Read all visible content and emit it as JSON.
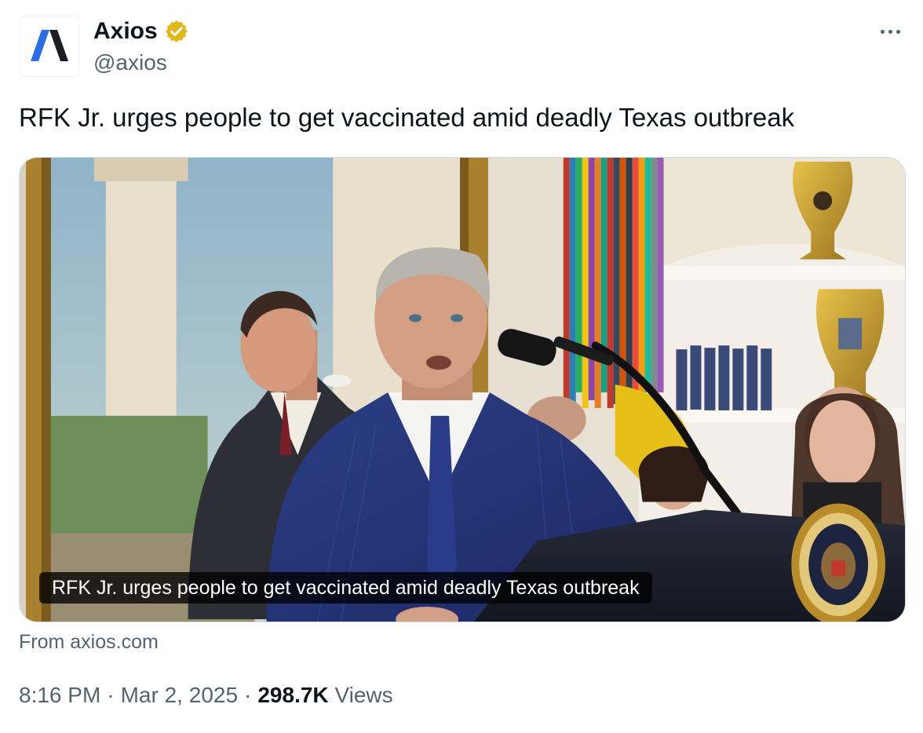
{
  "author": {
    "display_name": "Axios",
    "handle": "@axios",
    "verified": true,
    "verified_color": "#e2b719"
  },
  "tweet": {
    "text": "RFK Jr. urges people to get vaccinated amid deadly Texas outbreak"
  },
  "media": {
    "caption": "RFK Jr. urges people to get vaccinated amid deadly Texas outbreak",
    "source": "From axios.com"
  },
  "meta": {
    "time": "8:16 PM",
    "separator": "·",
    "date": "Mar 2, 2025",
    "views_count": "298.7K",
    "views_label": "Views"
  },
  "icons": {
    "logo": "axios-logo-icon",
    "verified": "verified-badge-icon",
    "more": "more-options-icon"
  },
  "colors": {
    "logo_blue": "#2b6de5",
    "logo_dark": "#1b1f24",
    "text_primary": "#0f1419",
    "text_secondary": "#536471"
  }
}
